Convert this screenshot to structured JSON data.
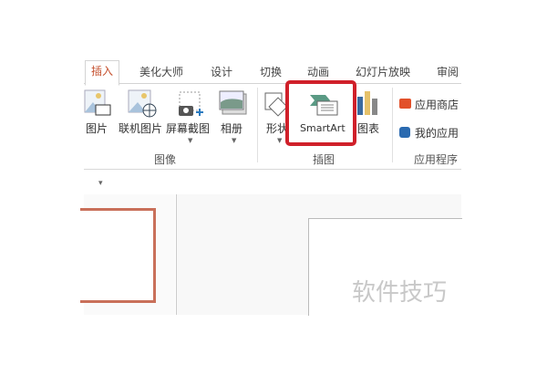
{
  "tabs": [
    "插入",
    "美化大师",
    "设计",
    "切换",
    "动画",
    "幻灯片放映",
    "审阅"
  ],
  "active_tab": "插入",
  "buttons": {
    "picture": "图片",
    "online_picture": "联机图片",
    "screenshot": "屏幕截图",
    "album": "相册",
    "shapes": "形状",
    "smartart": "SmartArt",
    "chart": "图表",
    "store": "应用商店",
    "my_apps": "我的应用"
  },
  "groups": {
    "images": "图像",
    "illustrations": "插图",
    "apps": "应用程序"
  },
  "watermark": "软件技巧",
  "colors": {
    "accent": "#c5502e",
    "highlight": "#d0202a"
  }
}
